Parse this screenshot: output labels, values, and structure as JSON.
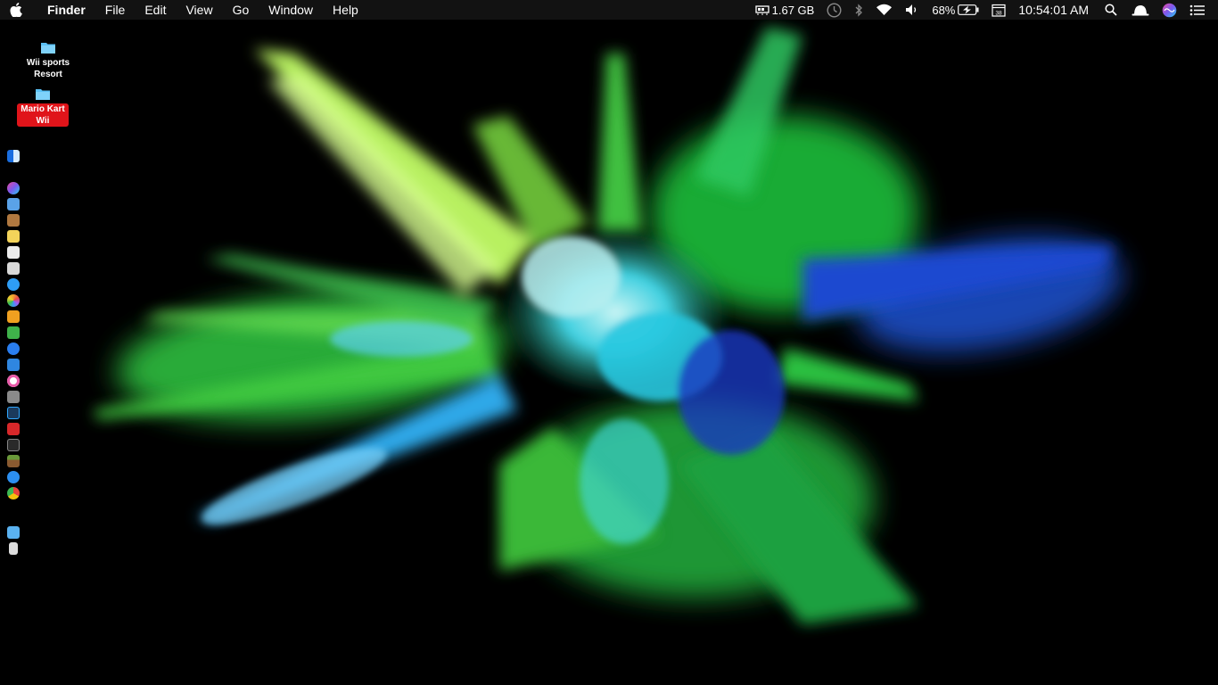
{
  "menubar": {
    "apple_icon": "apple-icon",
    "app_name": "Finder",
    "menus": [
      "File",
      "Edit",
      "View",
      "Go",
      "Window",
      "Help"
    ],
    "memory": "1.67 GB",
    "battery_percent": "68%",
    "battery_level": 0.68,
    "clock": "10:54:01 AM",
    "status_icons": [
      "memory-icon",
      "time-machine-icon",
      "bluetooth-icon",
      "wifi-icon",
      "volume-icon",
      "battery-icon",
      "calendar-icon",
      "spotlight-icon",
      "ghost-icon",
      "siri-icon",
      "notification-center-icon"
    ]
  },
  "desktop": {
    "items": [
      {
        "label": "Wii sports Resort",
        "icon": "folder-icon",
        "selected": false
      },
      {
        "label": "Mario Kart Wii",
        "icon": "folder-icon",
        "selected": true
      }
    ]
  },
  "dock": {
    "items": [
      {
        "name": "finder",
        "color": "#3b8ee8"
      },
      {
        "name": "siri",
        "color": "#7a5af0"
      },
      {
        "name": "preview",
        "color": "#5aa2e8"
      },
      {
        "name": "contacts",
        "color": "#b07840"
      },
      {
        "name": "notes",
        "color": "#f3d35a"
      },
      {
        "name": "textedit",
        "color": "#e8e8e8"
      },
      {
        "name": "photo-booth",
        "color": "#d8d8d8"
      },
      {
        "name": "messages",
        "color": "#2e9df5"
      },
      {
        "name": "photos",
        "color": "#f0a030"
      },
      {
        "name": "pages",
        "color": "#f0a020"
      },
      {
        "name": "numbers",
        "color": "#3fb24a"
      },
      {
        "name": "app-store",
        "color": "#2a7ef0"
      },
      {
        "name": "keynote",
        "color": "#2f86e0"
      },
      {
        "name": "itunes",
        "color": "#e85aa8"
      },
      {
        "name": "screenshot",
        "color": "#8a8a8a"
      },
      {
        "name": "photoshop",
        "color": "#1b3a5c"
      },
      {
        "name": "parallels",
        "color": "#d8282a"
      },
      {
        "name": "terminal",
        "color": "#2a2a2a"
      },
      {
        "name": "minecraft",
        "color": "#6a9a3a"
      },
      {
        "name": "safari",
        "color": "#2c8ff0"
      },
      {
        "name": "chrome",
        "color": "#e8453c"
      },
      {
        "name": "downloads-folder",
        "color": "#5ab2f0"
      },
      {
        "name": "trash",
        "color": "#dcdcdc"
      }
    ]
  },
  "colors": {
    "menubar_bg": "#121212",
    "selection_red": "#e0141a",
    "folder_blue": "#5ac0f5"
  }
}
